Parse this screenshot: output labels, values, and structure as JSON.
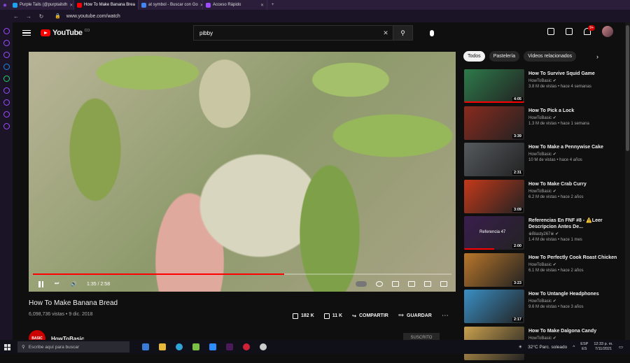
{
  "browser": {
    "tabs": [
      {
        "label": "Purple Tails (@purptailsth",
        "color": "#1da1f2"
      },
      {
        "label": "How To Make Banana Brea",
        "color": "#ff0000"
      },
      {
        "label": "at symbol - Buscar con Go",
        "color": "#4285f4"
      },
      {
        "label": "Acceso Rápido",
        "color": "#9d4dff"
      }
    ],
    "url": "www.youtube.com/watch"
  },
  "header": {
    "logo_text": "YouTube",
    "logo_suffix": "CO",
    "search_value": "pibby",
    "notifications_badge": "9+"
  },
  "player": {
    "progress": 0.6,
    "time": "1:35 / 2:58"
  },
  "video": {
    "title": "How To Make Banana Bread",
    "meta": "6,098,736 vistas • 9 dic. 2018",
    "likes": "182 K",
    "dislikes": "11 K",
    "share_label": "COMPARTIR",
    "save_label": "GUARDAR",
    "channel": "HowToBasic",
    "channel_avatar_text": "BASIC",
    "subscribe_label": "SUSCRITO"
  },
  "chips": [
    "Todos",
    "Pastelería",
    "Videos relacionados"
  ],
  "recommendations": [
    {
      "title": "How To Survive Squid Game",
      "channel": "HowToBasic",
      "meta": "3.8 M de vistas • hace 4 semanas",
      "duration": "4:05",
      "thumb": "#2d7a4a",
      "watched": 1.0
    },
    {
      "title": "How To Pick a Lock",
      "channel": "HowToBasic",
      "meta": "1.3 M de vistas • hace 1 semana",
      "duration": "3:39",
      "thumb": "#8a2a1e",
      "watched": 0
    },
    {
      "title": "How To Make a Pennywise Cake",
      "channel": "HowToBasic",
      "meta": "10 M de vistas • hace 4 años",
      "duration": "2:31",
      "thumb": "#555a5e",
      "watched": 0
    },
    {
      "title": "How To Make Crab Curry",
      "channel": "HowToBasic",
      "meta": "6.2 M de vistas • hace 2 años",
      "duration": "3:09",
      "thumb": "#c4391a",
      "watched": 0
    },
    {
      "title": "Referencias En FNF #8 - ⚠️Leer Descripcion Antes De...",
      "channel": "※Blasty267※",
      "meta": "1.4 M de vistas • hace 1 mes",
      "duration": "2:00",
      "thumb": "#3a1e4e",
      "watched": 0.5,
      "thumb_text": "Referencia 47"
    },
    {
      "title": "How To Perfectly Cook Roast Chicken",
      "channel": "HowToBasic",
      "meta": "6.1 M de vistas • hace 2 años",
      "duration": "3:23",
      "thumb": "#b8762a",
      "watched": 0
    },
    {
      "title": "How To Untangle Headphones",
      "channel": "HowToBasic",
      "meta": "9.6 M de vistas • hace 3 años",
      "duration": "2:17",
      "thumb": "#3a8fc4",
      "watched": 0
    },
    {
      "title": "How To Make Dalgona Candy",
      "channel": "HowToBasic",
      "meta": "",
      "duration": "",
      "thumb": "#c9a04e",
      "watched": 0
    }
  ],
  "taskbar": {
    "search_placeholder": "Escribe aquí para buscar",
    "weather": "32°C  Parc. soleado",
    "lang1": "ESP",
    "lang2": "ES",
    "time": "12:33 p. m.",
    "date": "7/11/2021"
  }
}
